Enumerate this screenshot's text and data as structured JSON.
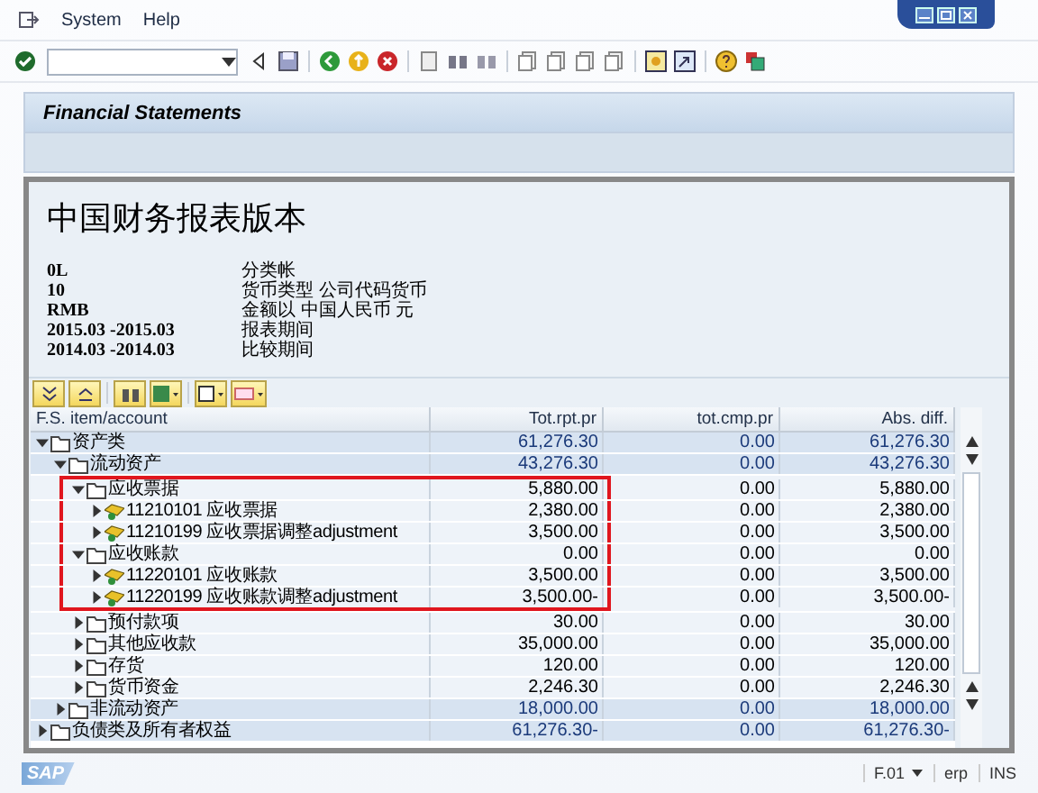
{
  "menu": [
    "System",
    "Help"
  ],
  "screen_title": "Financial Statements",
  "report": {
    "title": "中国财务报表版本",
    "info": [
      {
        "key": "0L",
        "text": "分类帐"
      },
      {
        "key": "10",
        "text": "货币类型  公司代码货币"
      },
      {
        "key": "RMB",
        "text": "金额以  中国人民币  元"
      },
      {
        "key": "2015.03 -2015.03",
        "text": "报表期间"
      },
      {
        "key": "2014.03 -2014.03",
        "text": "比较期间"
      }
    ]
  },
  "table": {
    "columns": [
      "F.S. item/account",
      "Tot.rpt.pr",
      "tot.cmp.pr",
      "Abs. diff."
    ],
    "rows": [
      {
        "kind": "folder",
        "label": "资产类",
        "expanded": true,
        "highlighted": false,
        "values": [
          "61,276.30",
          "0.00",
          "61,276.30"
        ],
        "children": [
          {
            "kind": "folder",
            "label": "流动资产",
            "expanded": true,
            "highlighted": false,
            "values": [
              "43,276.30",
              "0.00",
              "43,276.30"
            ],
            "children": [
              {
                "kind": "folder",
                "label": "应收票据",
                "expanded": true,
                "highlighted": true,
                "values": [
                  "5,880.00",
                  "0.00",
                  "5,880.00"
                ],
                "children": [
                  {
                    "kind": "account",
                    "label": "11210101 应收票据",
                    "expanded": false,
                    "highlighted": true,
                    "values": [
                      "2,380.00",
                      "0.00",
                      "2,380.00"
                    ]
                  },
                  {
                    "kind": "account",
                    "label": "11210199 应收票据调整adjustment",
                    "expanded": false,
                    "highlighted": true,
                    "values": [
                      "3,500.00",
                      "0.00",
                      "3,500.00"
                    ]
                  }
                ]
              },
              {
                "kind": "folder",
                "label": "应收账款",
                "expanded": true,
                "highlighted": true,
                "values": [
                  "0.00",
                  "0.00",
                  "0.00"
                ],
                "children": [
                  {
                    "kind": "account",
                    "label": "11220101 应收账款",
                    "expanded": false,
                    "highlighted": true,
                    "values": [
                      "3,500.00",
                      "0.00",
                      "3,500.00"
                    ]
                  },
                  {
                    "kind": "account",
                    "label": "11220199 应收账款调整adjustment",
                    "expanded": false,
                    "highlighted": true,
                    "values": [
                      "3,500.00-",
                      "0.00",
                      "3,500.00-"
                    ]
                  }
                ]
              },
              {
                "kind": "folder",
                "label": "预付款项",
                "expanded": false,
                "highlighted": false,
                "values": [
                  "30.00",
                  "0.00",
                  "30.00"
                ]
              },
              {
                "kind": "folder",
                "label": "其他应收款",
                "expanded": false,
                "highlighted": false,
                "values": [
                  "35,000.00",
                  "0.00",
                  "35,000.00"
                ]
              },
              {
                "kind": "folder",
                "label": "存货",
                "expanded": false,
                "highlighted": false,
                "values": [
                  "120.00",
                  "0.00",
                  "120.00"
                ]
              },
              {
                "kind": "folder",
                "label": "货币资金",
                "expanded": false,
                "highlighted": false,
                "values": [
                  "2,246.30",
                  "0.00",
                  "2,246.30"
                ]
              }
            ]
          },
          {
            "kind": "folder",
            "label": "非流动资产",
            "expanded": false,
            "highlighted": false,
            "values": [
              "18,000.00",
              "0.00",
              "18,000.00"
            ]
          }
        ]
      },
      {
        "kind": "folder",
        "label": "负债类及所有者权益",
        "expanded": false,
        "highlighted": false,
        "values": [
          "61,276.30-",
          "0.00",
          "61,276.30-"
        ]
      }
    ]
  },
  "status_bar": {
    "logo": "SAP",
    "transaction": "F.01",
    "system": "erp",
    "mode": "INS"
  }
}
